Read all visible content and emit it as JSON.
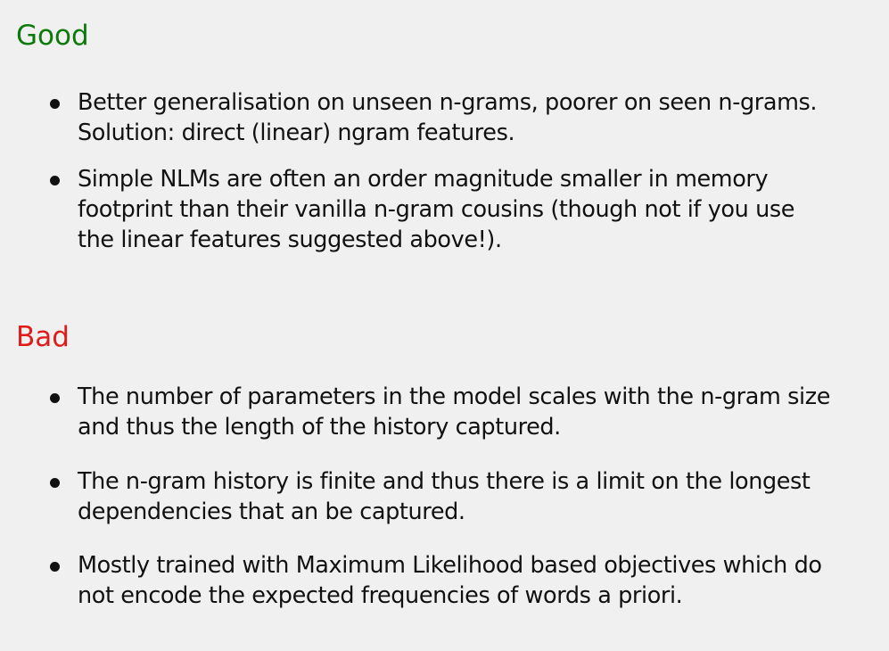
{
  "good": {
    "heading": "Good",
    "color": "#0b7a0b",
    "bullets": [
      {
        "lines": [
          "Better generalisation on unseen n-grams, poorer on seen n-grams.",
          "Solution: direct (linear) ngram features."
        ]
      },
      {
        "lines": [
          "Simple NLMs are often an order magnitude smaller in memory",
          "footprint than their vanilla n-gram cousins (though not if you use",
          "the linear features suggested above!)."
        ]
      }
    ]
  },
  "bad": {
    "heading": "Bad",
    "color": "#e11a1a",
    "bullets": [
      {
        "lines": [
          "The number of parameters in the model scales with the n-gram size",
          "and thus the length of the history captured."
        ]
      },
      {
        "lines": [
          "The n-gram history is finite and thus there is a limit on the longest",
          "dependencies that an be captured."
        ]
      },
      {
        "lines": [
          "Mostly trained with Maximum Likelihood based objectives which do",
          "not encode the expected frequencies of words a priori."
        ]
      }
    ]
  },
  "background_color": "#f0f0f0"
}
